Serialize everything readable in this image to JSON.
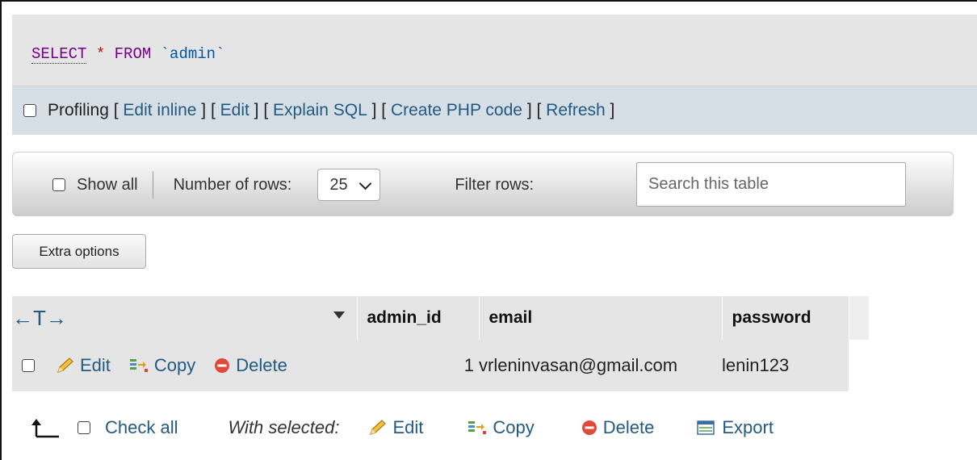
{
  "sql": {
    "select": "SELECT",
    "star": "*",
    "from": "FROM",
    "table": "`admin`"
  },
  "profiling": {
    "label": "Profiling",
    "links": [
      "Edit inline",
      "Edit",
      "Explain SQL",
      "Create PHP code",
      "Refresh"
    ]
  },
  "navigation": {
    "show_all_label": "Show all",
    "rows_label": "Number of rows:",
    "rows_value": "25",
    "filter_label": "Filter rows:",
    "search_placeholder": "Search this table"
  },
  "extra_options_label": "Extra options",
  "table": {
    "arrows_label": "←T→",
    "columns": [
      "admin_id",
      "email",
      "password"
    ],
    "rows": [
      {
        "edit": "Edit",
        "copy": "Copy",
        "delete": "Delete",
        "admin_id": "1",
        "email": "vrleninvasan@gmail.com",
        "password": "lenin123"
      }
    ]
  },
  "bulk": {
    "check_all": "Check all",
    "with_selected": "With selected:",
    "edit": "Edit",
    "copy": "Copy",
    "delete": "Delete",
    "export": "Export"
  },
  "colors": {
    "link": "#235a81",
    "keyword": "#770088",
    "header_bg": "#e5e5e5"
  }
}
